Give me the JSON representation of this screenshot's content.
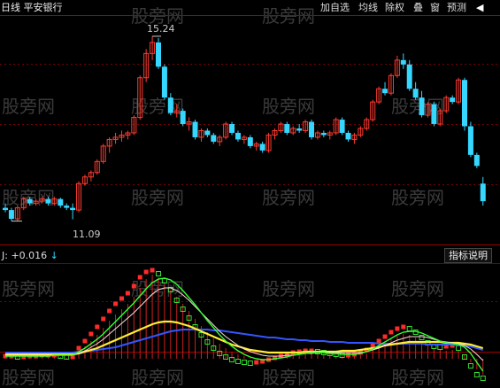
{
  "header": {
    "title": "日线 平安银行",
    "buttons": [
      "加自选",
      "均线",
      "除权",
      "叠",
      "窗",
      "预测"
    ],
    "menu_arrow": "◀"
  },
  "main_chart": {
    "high_label": "15.24",
    "low_label": "11.09",
    "price_range": [
      10.8,
      15.5
    ],
    "up_color": "#ff3b30",
    "down_color": "#35d7ff",
    "candles": [
      [
        11.35,
        11.45,
        11.25,
        11.3
      ],
      [
        11.3,
        11.35,
        11.05,
        11.1
      ],
      [
        11.1,
        11.4,
        11.05,
        11.35
      ],
      [
        11.35,
        11.6,
        11.3,
        11.55
      ],
      [
        11.55,
        11.6,
        11.4,
        11.45
      ],
      [
        11.45,
        11.55,
        11.4,
        11.5
      ],
      [
        11.5,
        11.6,
        11.45,
        11.55
      ],
      [
        11.55,
        11.6,
        11.4,
        11.45
      ],
      [
        11.45,
        11.6,
        11.4,
        11.55
      ],
      [
        11.55,
        11.58,
        11.35,
        11.4
      ],
      [
        11.4,
        11.45,
        11.3,
        11.35
      ],
      [
        11.35,
        11.45,
        11.09,
        11.3
      ],
      [
        11.3,
        11.95,
        11.25,
        11.9
      ],
      [
        11.9,
        12.1,
        11.85,
        12.05
      ],
      [
        12.05,
        12.2,
        11.95,
        12.15
      ],
      [
        12.15,
        12.45,
        12.1,
        12.4
      ],
      [
        12.4,
        12.8,
        12.35,
        12.75
      ],
      [
        12.75,
        12.95,
        12.6,
        12.9
      ],
      [
        12.9,
        13.05,
        12.8,
        12.95
      ],
      [
        12.95,
        13.1,
        12.85,
        13.0
      ],
      [
        13.0,
        13.1,
        12.9,
        13.05
      ],
      [
        13.05,
        13.45,
        13.0,
        13.4
      ],
      [
        13.4,
        14.35,
        13.35,
        14.3
      ],
      [
        14.3,
        14.95,
        14.2,
        14.85
      ],
      [
        14.85,
        15.24,
        14.7,
        15.1
      ],
      [
        15.1,
        15.2,
        14.5,
        14.55
      ],
      [
        14.55,
        14.6,
        13.8,
        13.85
      ],
      [
        13.85,
        13.95,
        13.45,
        13.5
      ],
      [
        13.5,
        13.7,
        13.4,
        13.55
      ],
      [
        13.55,
        13.6,
        13.2,
        13.25
      ],
      [
        13.25,
        13.4,
        13.1,
        13.3
      ],
      [
        13.3,
        13.35,
        12.9,
        12.95
      ],
      [
        12.95,
        13.15,
        12.85,
        13.1
      ],
      [
        13.1,
        13.15,
        12.95,
        13.0
      ],
      [
        13.0,
        13.05,
        12.8,
        12.85
      ],
      [
        12.85,
        13.0,
        12.75,
        12.95
      ],
      [
        12.95,
        13.3,
        12.9,
        13.25
      ],
      [
        13.25,
        13.3,
        13.0,
        13.05
      ],
      [
        13.05,
        13.1,
        12.85,
        12.9
      ],
      [
        12.9,
        13.0,
        12.8,
        12.95
      ],
      [
        12.95,
        13.0,
        12.7,
        12.75
      ],
      [
        12.75,
        12.85,
        12.65,
        12.8
      ],
      [
        12.8,
        12.85,
        12.6,
        12.65
      ],
      [
        12.65,
        13.05,
        12.6,
        13.0
      ],
      [
        13.0,
        13.15,
        12.9,
        13.1
      ],
      [
        13.1,
        13.3,
        13.05,
        13.25
      ],
      [
        13.25,
        13.3,
        13.0,
        13.05
      ],
      [
        13.05,
        13.2,
        13.0,
        13.15
      ],
      [
        13.15,
        13.25,
        13.05,
        13.1
      ],
      [
        13.1,
        13.35,
        13.05,
        13.3
      ],
      [
        13.3,
        13.35,
        12.9,
        12.95
      ],
      [
        12.95,
        13.1,
        12.9,
        13.05
      ],
      [
        13.05,
        13.1,
        12.95,
        13.0
      ],
      [
        13.0,
        13.1,
        12.9,
        13.05
      ],
      [
        13.05,
        13.4,
        13.0,
        13.35
      ],
      [
        13.35,
        13.4,
        13.0,
        13.05
      ],
      [
        13.05,
        13.1,
        12.85,
        12.9
      ],
      [
        12.9,
        13.05,
        12.8,
        13.0
      ],
      [
        13.0,
        13.2,
        12.95,
        13.15
      ],
      [
        13.15,
        13.4,
        13.1,
        13.35
      ],
      [
        13.35,
        13.8,
        13.3,
        13.75
      ],
      [
        13.75,
        14.1,
        13.7,
        14.05
      ],
      [
        14.05,
        14.2,
        13.9,
        13.95
      ],
      [
        13.95,
        14.4,
        13.9,
        14.35
      ],
      [
        14.35,
        14.8,
        14.3,
        14.7
      ],
      [
        14.7,
        14.85,
        14.5,
        14.6
      ],
      [
        14.6,
        14.7,
        14.0,
        14.05
      ],
      [
        14.05,
        14.2,
        13.8,
        13.85
      ],
      [
        13.85,
        14.0,
        13.4,
        13.45
      ],
      [
        13.45,
        13.75,
        13.4,
        13.7
      ],
      [
        13.7,
        13.75,
        13.2,
        13.25
      ],
      [
        13.25,
        13.6,
        13.2,
        13.55
      ],
      [
        13.55,
        13.9,
        13.5,
        13.85
      ],
      [
        13.85,
        13.9,
        13.7,
        13.75
      ],
      [
        13.75,
        14.3,
        13.7,
        14.25
      ],
      [
        14.25,
        14.3,
        13.1,
        13.2
      ],
      [
        13.2,
        13.3,
        12.5,
        12.55
      ],
      [
        12.55,
        12.6,
        12.25,
        12.3
      ],
      [
        11.9,
        12.05,
        11.4,
        11.5
      ]
    ]
  },
  "indicator": {
    "label_prefix": "J:",
    "value": "+0.016",
    "arrow": "↓",
    "explain_button": "指标说明",
    "base": 0,
    "range": [
      -25,
      105
    ],
    "bar_values": [
      2,
      2,
      1,
      1,
      2,
      2,
      3,
      3,
      3,
      2,
      1,
      1,
      8,
      14,
      20,
      27,
      35,
      43,
      50,
      56,
      62,
      70,
      80,
      90,
      95,
      92,
      86,
      78,
      70,
      62,
      54,
      45,
      37,
      30,
      23,
      17,
      12,
      8,
      5,
      3,
      1,
      0,
      -1,
      0,
      1,
      3,
      5,
      6,
      7,
      8,
      8,
      7,
      6,
      5,
      5,
      4,
      3,
      3,
      4,
      6,
      10,
      14,
      18,
      22,
      26,
      28,
      27,
      24,
      20,
      16,
      12,
      10,
      9,
      10,
      9,
      4,
      -4,
      -12,
      -18
    ],
    "sq_values": [
      3,
      3,
      2,
      2,
      3,
      3,
      4,
      4,
      4,
      3,
      2,
      2,
      12,
      20,
      28,
      36,
      45,
      54,
      62,
      68,
      74,
      82,
      92,
      98,
      100,
      96,
      88,
      78,
      66,
      56,
      46,
      36,
      27,
      19,
      12,
      6,
      2,
      -1,
      -3,
      -4,
      -5,
      -4,
      -3,
      -1,
      1,
      3,
      5,
      7,
      8,
      9,
      9,
      8,
      7,
      6,
      5,
      4,
      4,
      5,
      7,
      10,
      15,
      20,
      25,
      30,
      34,
      36,
      34,
      30,
      24,
      18,
      14,
      13,
      14,
      15,
      12,
      2,
      -8,
      -18,
      -22
    ],
    "green_values": [
      3,
      3,
      3,
      3,
      3,
      3,
      3,
      3,
      4,
      4,
      4,
      4,
      8,
      12,
      17,
      22,
      28,
      35,
      42,
      49,
      56,
      63,
      71,
      79,
      86,
      90,
      91,
      89,
      84,
      77,
      69,
      61,
      52,
      43,
      35,
      27,
      20,
      14,
      9,
      5,
      2,
      0,
      -1,
      -1,
      0,
      1,
      2,
      4,
      5,
      6,
      7,
      7,
      7,
      6,
      6,
      5,
      5,
      5,
      6,
      8,
      11,
      15,
      19,
      23,
      27,
      30,
      31,
      31,
      29,
      26,
      23,
      20,
      18,
      17,
      16,
      13,
      6,
      -4,
      -14
    ],
    "white_values": [
      4,
      4,
      4,
      4,
      4,
      4,
      4,
      4,
      4,
      4,
      4,
      4,
      6,
      9,
      13,
      17,
      22,
      28,
      34,
      40,
      46,
      52,
      59,
      66,
      73,
      78,
      80,
      80,
      77,
      72,
      66,
      59,
      52,
      45,
      38,
      31,
      25,
      20,
      15,
      11,
      8,
      6,
      4,
      3,
      3,
      3,
      4,
      4,
      5,
      6,
      6,
      7,
      7,
      7,
      7,
      7,
      7,
      7,
      7,
      8,
      10,
      12,
      15,
      18,
      21,
      23,
      25,
      25,
      25,
      24,
      22,
      20,
      19,
      18,
      17,
      15,
      11,
      5,
      -2
    ],
    "yellow_values": [
      5,
      5,
      5,
      5,
      5,
      5,
      5,
      5,
      5,
      5,
      5,
      5,
      6,
      8,
      10,
      12,
      15,
      18,
      21,
      24,
      27,
      30,
      33,
      36,
      39,
      41,
      42,
      42,
      41,
      39,
      37,
      34,
      31,
      28,
      25,
      22,
      19,
      16,
      14,
      12,
      10,
      9,
      8,
      7,
      7,
      7,
      7,
      7,
      7,
      8,
      8,
      8,
      8,
      8,
      8,
      9,
      9,
      9,
      10,
      11,
      12,
      13,
      15,
      16,
      17,
      18,
      19,
      19,
      19,
      19,
      19,
      19,
      18,
      18,
      18,
      17,
      16,
      14,
      12
    ],
    "blue_values": [
      7,
      7,
      7,
      7,
      7,
      7,
      7,
      7,
      7,
      7,
      7,
      7,
      8,
      8,
      9,
      10,
      11,
      12,
      13,
      15,
      17,
      19,
      21,
      23,
      25,
      27,
      29,
      31,
      32,
      33,
      33,
      33,
      33,
      33,
      32,
      32,
      31,
      30,
      29,
      28,
      27,
      26,
      25,
      24,
      24,
      23,
      22,
      22,
      21,
      21,
      20,
      20,
      20,
      19,
      19,
      19,
      18,
      18,
      18,
      18,
      18,
      17,
      17,
      17,
      17,
      17,
      17,
      17,
      17,
      16,
      16,
      16,
      16,
      16,
      15,
      15,
      14,
      12,
      10
    ]
  },
  "watermark": "股旁网",
  "colors": {
    "grid": "#7a0000",
    "frame": "#a00000",
    "text_label": "#cccccc"
  }
}
